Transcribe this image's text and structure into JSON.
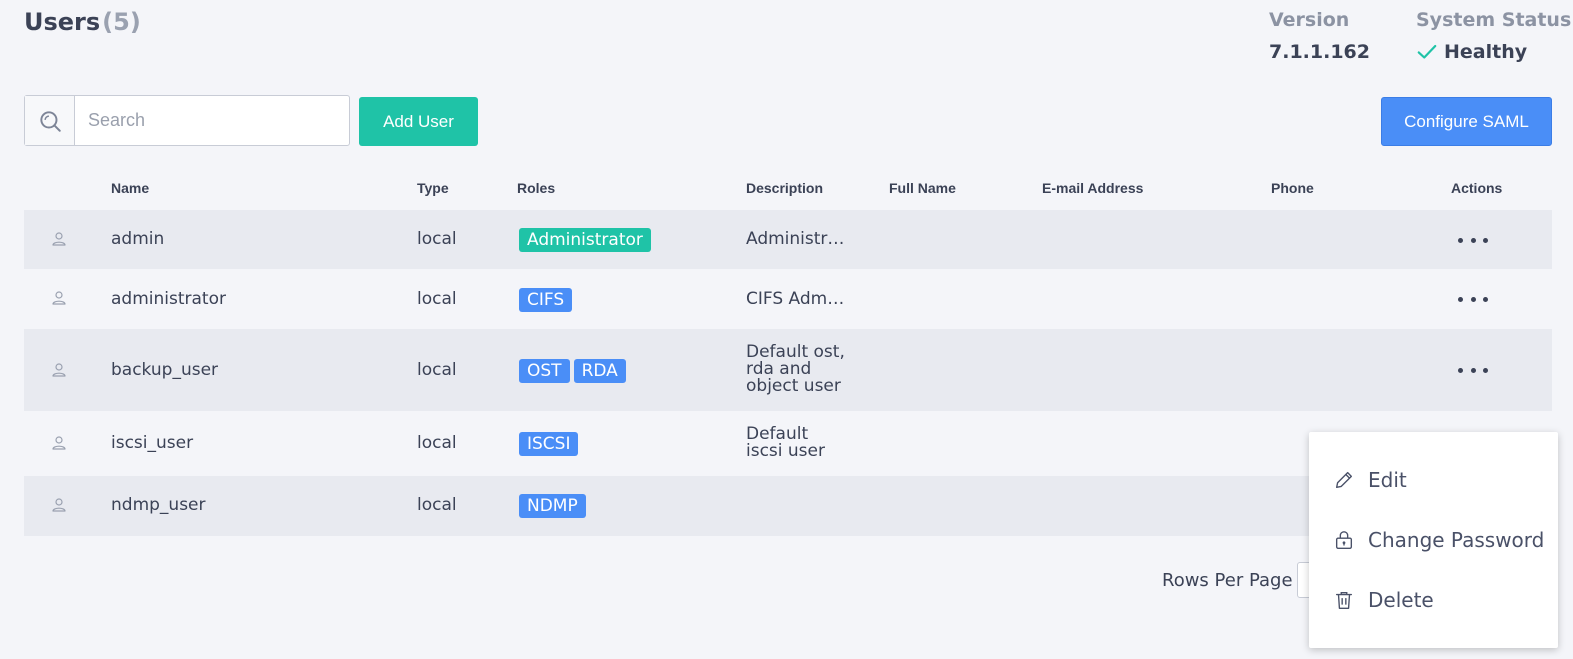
{
  "header": {
    "title": "Users",
    "count": "(5)",
    "version_label": "Version",
    "version_value": "7.1.1.162",
    "status_label": "System Status",
    "status_value": "Healthy",
    "status_color": "#1fc3a7"
  },
  "toolbar": {
    "search_placeholder": "Search",
    "search_value": "",
    "add_user_label": "Add User",
    "configure_saml_label": "Configure SAML"
  },
  "table": {
    "columns": [
      "Name",
      "Type",
      "Roles",
      "Description",
      "Full Name",
      "E-mail Address",
      "Phone",
      "Actions"
    ],
    "rows": [
      {
        "name": "admin",
        "type": "local",
        "roles": [
          "Administrator"
        ],
        "description": "Administr…",
        "full_name": "",
        "email": "",
        "phone": ""
      },
      {
        "name": "administrator",
        "type": "local",
        "roles": [
          "CIFS"
        ],
        "description": "CIFS Adm…",
        "full_name": "",
        "email": "",
        "phone": ""
      },
      {
        "name": "backup_user",
        "type": "local",
        "roles": [
          "OST",
          "RDA"
        ],
        "description": "Default ost, rda and object user",
        "full_name": "",
        "email": "",
        "phone": ""
      },
      {
        "name": "iscsi_user",
        "type": "local",
        "roles": [
          "ISCSI"
        ],
        "description": "Default iscsi user",
        "full_name": "",
        "email": "",
        "phone": ""
      },
      {
        "name": "ndmp_user",
        "type": "local",
        "roles": [
          "NDMP"
        ],
        "description": "",
        "full_name": "",
        "email": "",
        "phone": ""
      }
    ]
  },
  "pagination": {
    "rows_per_page_label": "Rows Per Page"
  },
  "context_menu": {
    "items": [
      {
        "label": "Edit",
        "icon": "pencil-icon"
      },
      {
        "label": "Change Password",
        "icon": "lock-icon"
      },
      {
        "label": "Delete",
        "icon": "trash-icon"
      }
    ]
  },
  "colors": {
    "accent_teal": "#1fc3a7",
    "accent_blue": "#4a8ef7"
  }
}
